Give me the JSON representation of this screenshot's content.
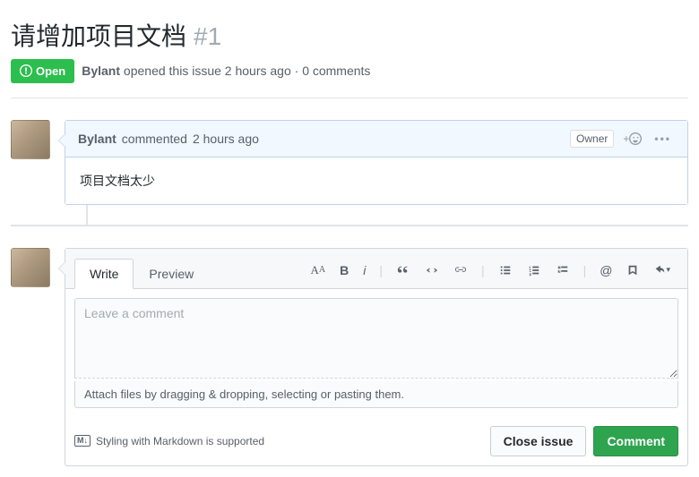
{
  "issue": {
    "title": "请增加项目文档",
    "number": "#1",
    "state": "Open",
    "author": "Bylant",
    "opened_verb": "opened this issue",
    "opened_time": "2 hours ago",
    "comment_count": "0 comments"
  },
  "comment": {
    "author": "Bylant",
    "action": "commented",
    "time": "2 hours ago",
    "owner_badge": "Owner",
    "body": "项目文档太少"
  },
  "editor": {
    "tabs": {
      "write": "Write",
      "preview": "Preview"
    },
    "placeholder": "Leave a comment",
    "attach_hint": "Attach files by dragging & dropping, selecting or pasting them.",
    "md_hint": "Styling with Markdown is supported",
    "md_badge": "M↓"
  },
  "buttons": {
    "close": "Close issue",
    "comment": "Comment"
  }
}
